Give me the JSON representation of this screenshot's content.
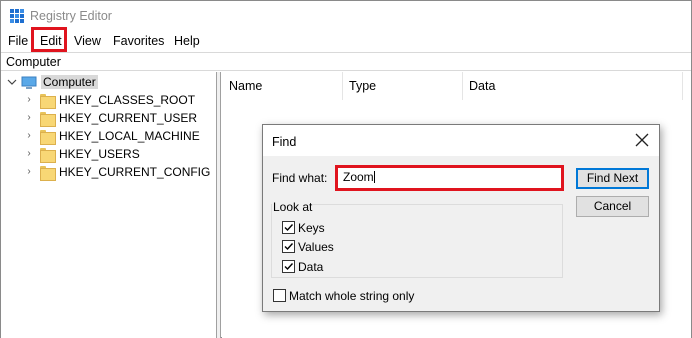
{
  "window": {
    "title": "Registry Editor"
  },
  "menu": {
    "items": [
      {
        "label": "File"
      },
      {
        "label": "Edit"
      },
      {
        "label": "View"
      },
      {
        "label": "Favorites"
      },
      {
        "label": "Help"
      }
    ],
    "highlighted": "Edit"
  },
  "address": {
    "path": "Computer"
  },
  "tree": {
    "root": {
      "label": "Computer",
      "icon": "computer-icon",
      "expanded": true,
      "selected": true
    },
    "children": [
      {
        "label": "HKEY_CLASSES_ROOT",
        "icon": "folder-icon"
      },
      {
        "label": "HKEY_CURRENT_USER",
        "icon": "folder-icon"
      },
      {
        "label": "HKEY_LOCAL_MACHINE",
        "icon": "folder-icon"
      },
      {
        "label": "HKEY_USERS",
        "icon": "folder-icon"
      },
      {
        "label": "HKEY_CURRENT_CONFIG",
        "icon": "folder-icon"
      }
    ]
  },
  "list": {
    "columns": [
      {
        "label": "Name"
      },
      {
        "label": "Type"
      },
      {
        "label": "Data"
      }
    ]
  },
  "find_dialog": {
    "title": "Find",
    "find_what_label": "Find what:",
    "find_what_value": "Zoom",
    "find_next_label": "Find Next",
    "cancel_label": "Cancel",
    "look_at_label": "Look at",
    "options": [
      {
        "label": "Keys",
        "checked": true
      },
      {
        "label": "Values",
        "checked": true
      },
      {
        "label": "Data",
        "checked": true
      }
    ],
    "match_whole": {
      "label": "Match whole string only",
      "checked": false
    }
  },
  "colors": {
    "highlight_box": "#e0141e",
    "default_button_border": "#0078d7",
    "folder": "#f8d775",
    "selection": "#d9d9d9"
  }
}
